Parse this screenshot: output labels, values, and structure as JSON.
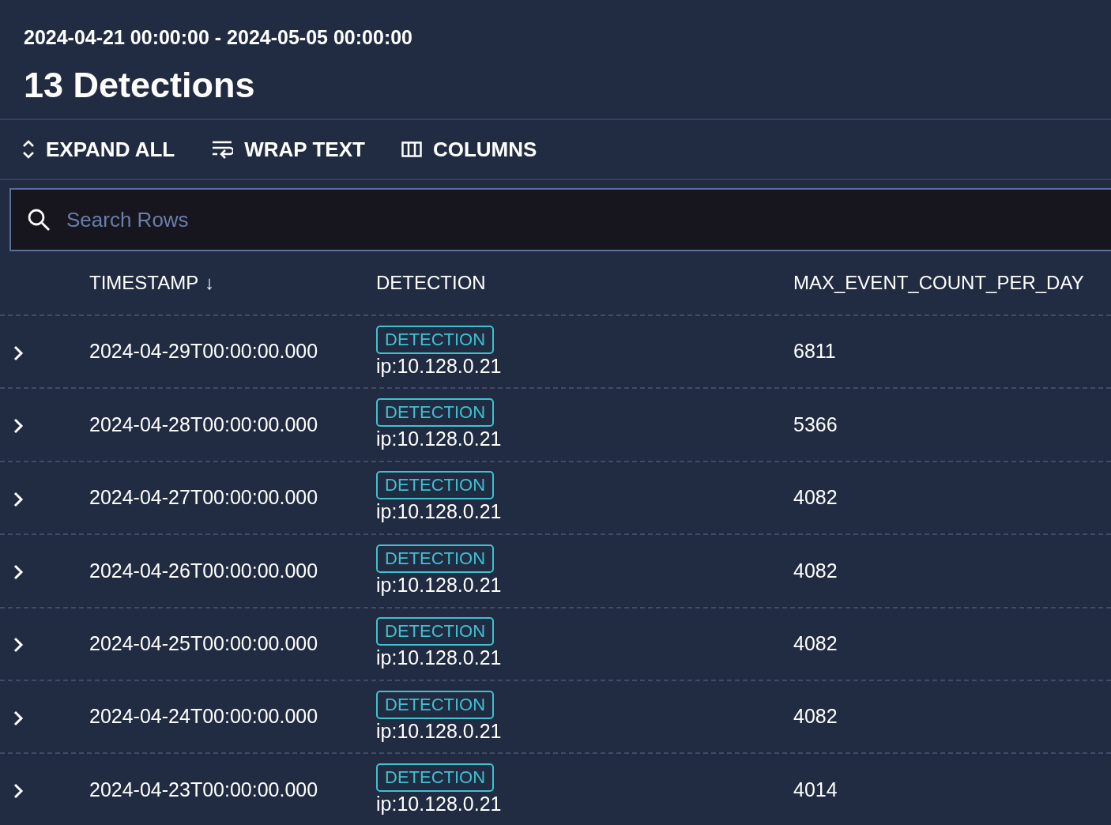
{
  "date_range": "2024-04-21 00:00:00 - 2024-05-05 00:00:00",
  "title": "13 Detections",
  "toolbar": [
    {
      "kind": "expand",
      "label": "EXPAND ALL"
    },
    {
      "kind": "wrap",
      "label": "WRAP TEXT"
    },
    {
      "kind": "columns",
      "label": "COLUMNS"
    }
  ],
  "search": {
    "placeholder": "Search Rows"
  },
  "columns": [
    {
      "label": "TIMESTAMP",
      "sort_arrow": "↓"
    },
    {
      "label": "DETECTION"
    },
    {
      "label": "MAX_EVENT_COUNT_PER_DAY"
    }
  ],
  "rows": [
    {
      "timestamp": "2024-04-29T00:00:00.000",
      "tag": "DETECTION",
      "detection": "ip:10.128.0.21",
      "max_event_count": "6811"
    },
    {
      "timestamp": "2024-04-28T00:00:00.000",
      "tag": "DETECTION",
      "detection": "ip:10.128.0.21",
      "max_event_count": "5366"
    },
    {
      "timestamp": "2024-04-27T00:00:00.000",
      "tag": "DETECTION",
      "detection": "ip:10.128.0.21",
      "max_event_count": "4082"
    },
    {
      "timestamp": "2024-04-26T00:00:00.000",
      "tag": "DETECTION",
      "detection": "ip:10.128.0.21",
      "max_event_count": "4082"
    },
    {
      "timestamp": "2024-04-25T00:00:00.000",
      "tag": "DETECTION",
      "detection": "ip:10.128.0.21",
      "max_event_count": "4082"
    },
    {
      "timestamp": "2024-04-24T00:00:00.000",
      "tag": "DETECTION",
      "detection": "ip:10.128.0.21",
      "max_event_count": "4082"
    },
    {
      "timestamp": "2024-04-23T00:00:00.000",
      "tag": "DETECTION",
      "detection": "ip:10.128.0.21",
      "max_event_count": "4014"
    }
  ]
}
